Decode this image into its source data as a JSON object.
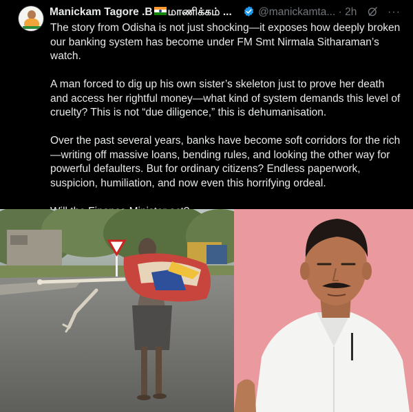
{
  "tweet": {
    "author_name": "Manickam Tagore .B",
    "author_name_tamil": "மாணிக்கம் ...",
    "handle": "@manickamta...",
    "separator": "·",
    "time": "2h",
    "more": "···",
    "paragraphs": [
      "The story from Odisha is not just shocking—it exposes how deeply broken our banking system has become under FM Smt Nirmala Sitharaman’s watch.",
      "A man forced to dig up his own sister’s skeleton just to prove her death and access her rightful money—what kind of system demands this level of cruelty? This is not “due diligence,” this is dehumanisation.",
      "Over the past several years, banks have become soft corridors for the rich —writing off massive loans, bending rules, and looking the other way for powerful defaulters. But for ordinary citizens? Endless paperwork, suspicion, humiliation, and now even this horrifying ordeal.",
      "Will the Finance Minister act?"
    ]
  },
  "colors": {
    "background": "#000000",
    "text": "#e7e9ea",
    "muted": "#71767b",
    "verified": "#1d9bf0",
    "pink_backdrop": "#e7949a"
  },
  "icons": {
    "verified": "verified-badge-icon",
    "grok": "grok-icon",
    "flag": "indian-flag-icon"
  }
}
